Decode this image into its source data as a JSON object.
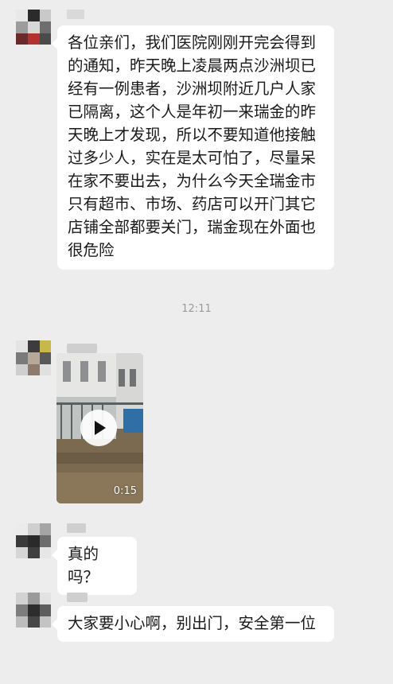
{
  "messages": [
    {
      "type": "text",
      "text": "各位亲们，我们医院刚刚开完会得到的通知，昨天晚上凌晨两点沙洲坝已经有一例患者，沙洲坝附近几户人家已隔离，这个人是年初一来瑞金的昨天晚上才发现，所以不要知道他接触过多少人，实在是太可怕了，尽量呆在家不要出去，为什么今天全瑞金市只有超市、市场、药店可以开门其它店铺全部都要关门，瑞金现在外面也很危险"
    },
    {
      "type": "timestamp",
      "text": "12:11"
    },
    {
      "type": "video",
      "duration": "0:15",
      "icon": "play-icon"
    },
    {
      "type": "text",
      "text": "真的吗？"
    },
    {
      "type": "text",
      "text": "大家要小心啊，别出门，安全第一位"
    }
  ],
  "colors": {
    "background": "#ededed",
    "bubble": "#ffffff",
    "timestamp": "#9a9a9a"
  }
}
